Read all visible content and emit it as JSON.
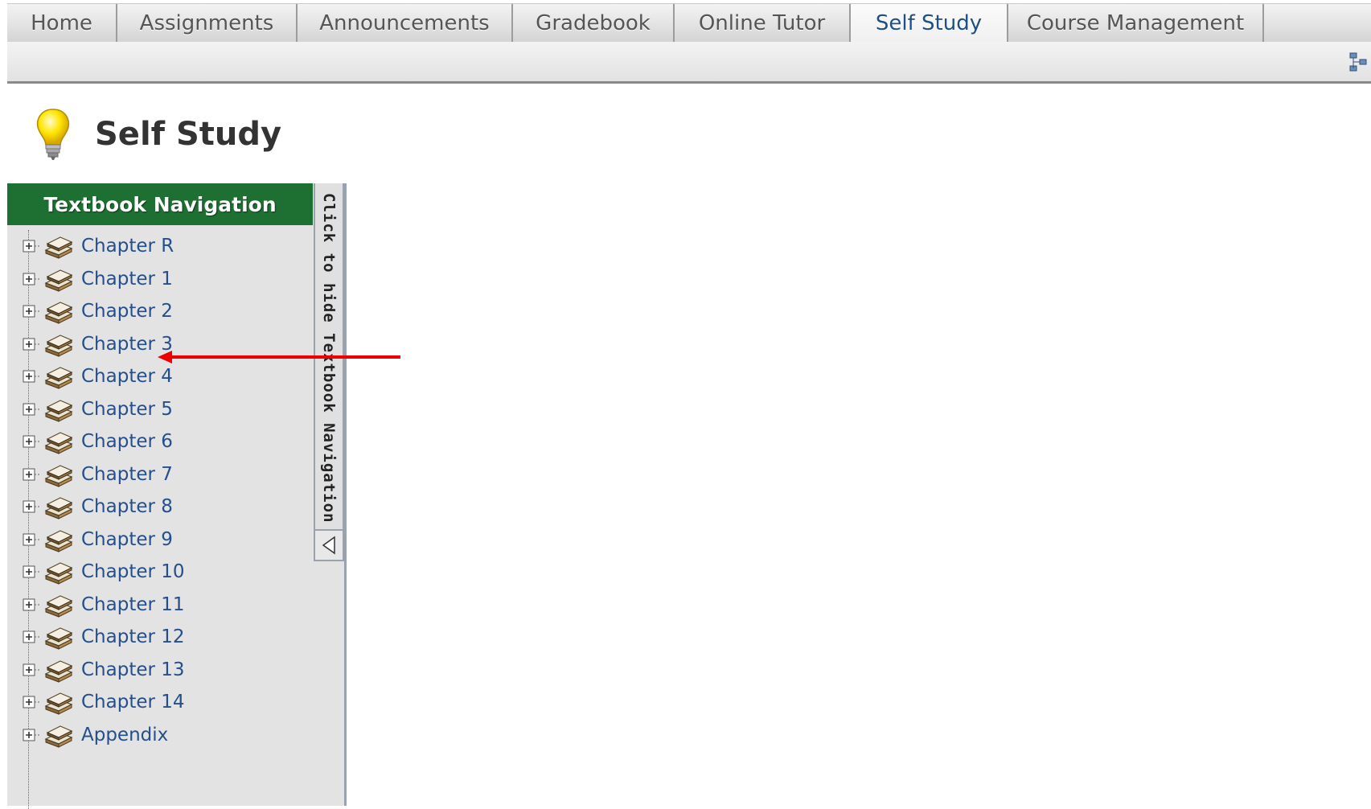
{
  "tabs": [
    {
      "label": "Home",
      "active": false,
      "width": 137
    },
    {
      "label": "Assignments",
      "active": false,
      "width": 224
    },
    {
      "label": "Announcements",
      "active": false,
      "width": 268
    },
    {
      "label": "Gradebook",
      "active": false,
      "width": 201
    },
    {
      "label": "Online Tutor",
      "active": false,
      "width": 219
    },
    {
      "label": "Self Study",
      "active": true,
      "width": 196
    },
    {
      "label": "Course Management",
      "active": false,
      "width": 318
    }
  ],
  "page": {
    "title": "Self Study",
    "icon": "lightbulb-icon"
  },
  "nav": {
    "header": "Textbook Navigation",
    "collapse_label": "Click to hide Textbook Navigation",
    "items": [
      {
        "label": "Chapter R"
      },
      {
        "label": "Chapter 1"
      },
      {
        "label": "Chapter 2"
      },
      {
        "label": "Chapter 3"
      },
      {
        "label": "Chapter 4"
      },
      {
        "label": "Chapter 5"
      },
      {
        "label": "Chapter 6"
      },
      {
        "label": "Chapter 7"
      },
      {
        "label": "Chapter 8"
      },
      {
        "label": "Chapter 9"
      },
      {
        "label": "Chapter 10"
      },
      {
        "label": "Chapter 11"
      },
      {
        "label": "Chapter 12"
      },
      {
        "label": "Chapter 13"
      },
      {
        "label": "Chapter 14"
      },
      {
        "label": "Appendix"
      }
    ]
  },
  "colors": {
    "nav_header": "#1d7031",
    "active_tab_text": "#1e4f86",
    "link": "#244f8c",
    "annotation_arrow": "#ee0000"
  },
  "annotation": {
    "type": "red-arrow",
    "points_to": "Chapter 3"
  }
}
